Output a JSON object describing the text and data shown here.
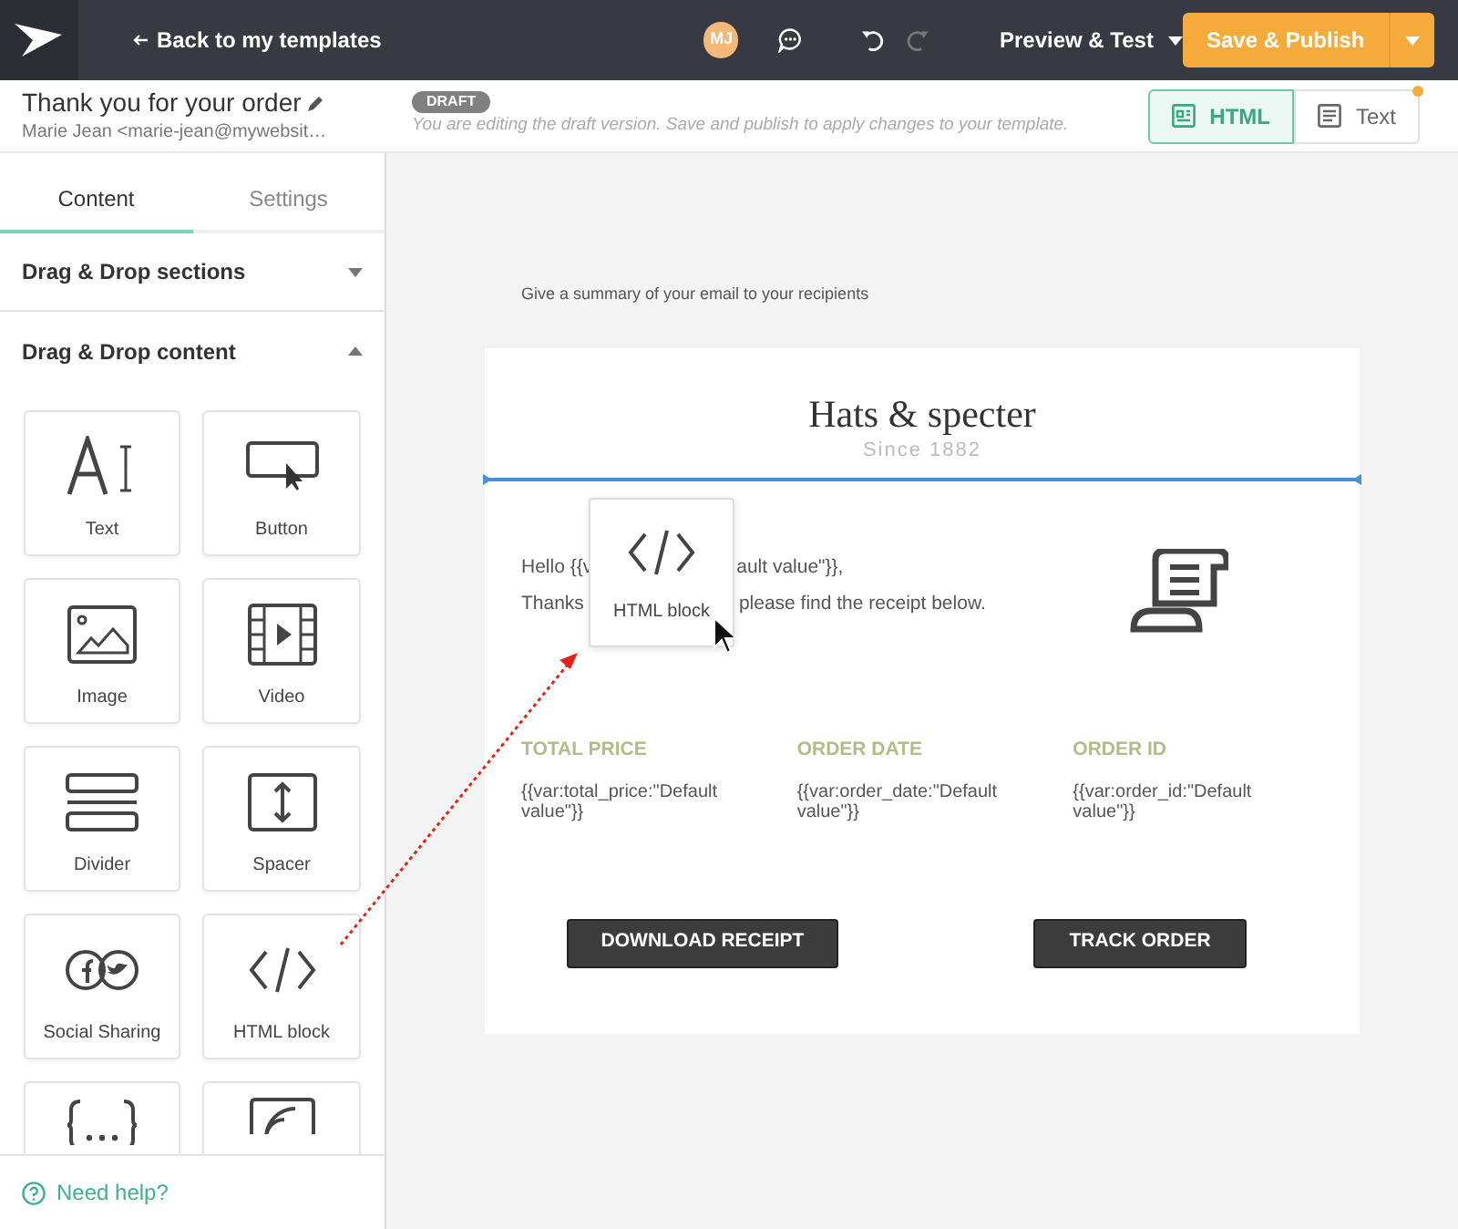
{
  "topbar": {
    "back": "Back to my templates",
    "avatar": "MJ",
    "preview": "Preview & Test",
    "publish": "Save & Publish"
  },
  "template": {
    "title": "Thank you for your order",
    "sender": "Marie Jean <marie-jean@mywebsit…",
    "badge": "DRAFT",
    "notice": "You are editing the draft version. Save and publish to apply changes to your template."
  },
  "format_tabs": [
    {
      "kind": "html",
      "label": "HTML",
      "selected": true,
      "dot": false
    },
    {
      "kind": "text",
      "label": "Text",
      "selected": false,
      "dot": true
    }
  ],
  "sidebar": {
    "tabs": [
      {
        "label": "Content",
        "selected": true
      },
      {
        "label": "Settings",
        "selected": false
      }
    ],
    "sections": [
      {
        "title": "Drag & Drop sections",
        "expanded": false
      },
      {
        "title": "Drag & Drop content",
        "expanded": true
      }
    ],
    "blocks": [
      {
        "kind": "text",
        "label": "Text"
      },
      {
        "kind": "button",
        "label": "Button"
      },
      {
        "kind": "image",
        "label": "Image"
      },
      {
        "kind": "video",
        "label": "Video"
      },
      {
        "kind": "divider",
        "label": "Divider"
      },
      {
        "kind": "spacer",
        "label": "Spacer"
      },
      {
        "kind": "social",
        "label": "Social Sharing"
      },
      {
        "kind": "html",
        "label": "HTML block"
      },
      {
        "kind": "variables"
      },
      {
        "kind": "rss"
      }
    ],
    "help": "Need help?"
  },
  "email": {
    "summary": "Give a summary of your email to your recipients",
    "brand": "Hats & specter",
    "since": "Since 1882",
    "greeting": [
      [
        "Hello {{v",
        "ault value\"}},"
      ],
      [
        "Thanks",
        "please find the receipt below."
      ]
    ],
    "stats": [
      {
        "label": "TOTAL PRICE",
        "value": "{{var:total_price:\"Default value\"}}"
      },
      {
        "label": "ORDER DATE",
        "value": "{{var:order_date:\"Default value\"}}"
      },
      {
        "label": "ORDER ID",
        "value": "{{var:order_id:\"Default value\"}}"
      }
    ],
    "buttons": [
      "DOWNLOAD RECEIPT",
      "TRACK ORDER"
    ]
  },
  "drag_ghost": {
    "label": "HTML block"
  }
}
